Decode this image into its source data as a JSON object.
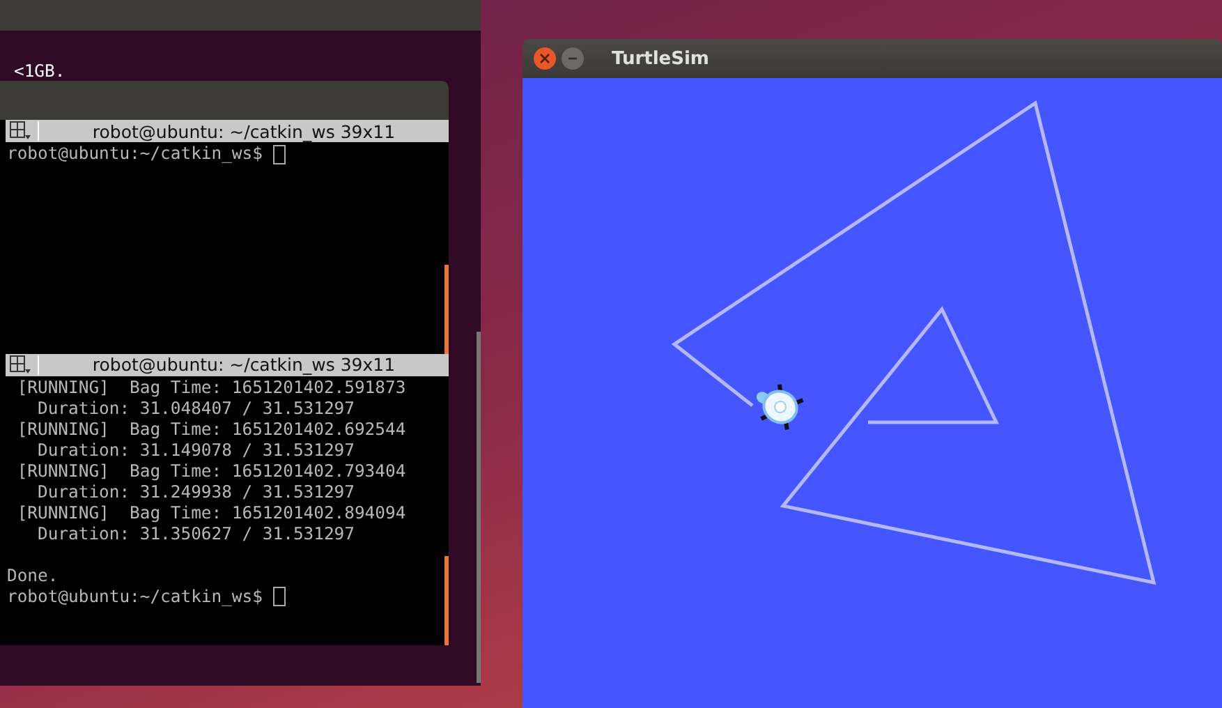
{
  "background_terminal": {
    "lines": [
      "<1GB."
    ]
  },
  "terminator": {
    "panes": [
      {
        "title": "robot@ubuntu: ~/catkin_ws 39x11",
        "prompt": "robot@ubuntu:~/catkin_ws$ "
      },
      {
        "title": "robot@ubuntu: ~/catkin_ws 39x11",
        "lines": [
          " [RUNNING]  Bag Time: 1651201402.591873",
          "   Duration: 31.048407 / 31.531297",
          " [RUNNING]  Bag Time: 1651201402.692544",
          "   Duration: 31.149078 / 31.531297",
          " [RUNNING]  Bag Time: 1651201402.793404",
          "   Duration: 31.249938 / 31.531297",
          " [RUNNING]  Bag Time: 1651201402.894094",
          "   Duration: 31.350627 / 31.531297"
        ],
        "final_lines": [
          "Done."
        ],
        "prompt": "robot@ubuntu:~/catkin_ws$ "
      }
    ]
  },
  "turtlesim": {
    "title": "TurtleSim"
  }
}
